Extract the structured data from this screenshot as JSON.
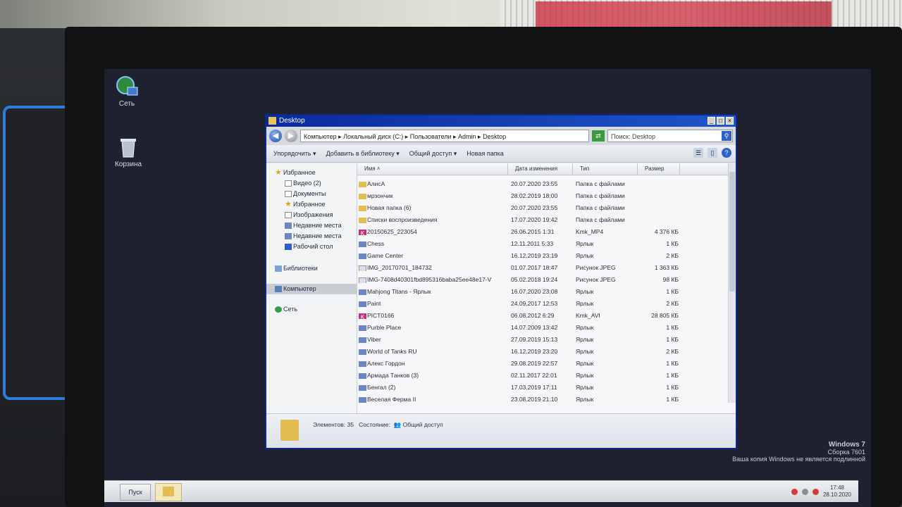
{
  "desktop": {
    "icons": [
      {
        "label": "Сеть",
        "icon": "network-icon"
      },
      {
        "label": "Корзина",
        "icon": "recycle-bin-icon"
      }
    ],
    "watermark": {
      "line1": "Windows 7",
      "line2": "Сборка 7601",
      "line3": "Ваша копия Windows не является подлинной"
    }
  },
  "window": {
    "title": "Desktop",
    "address": "Компьютер ▸ Локальный диск (C:) ▸ Пользователи ▸ Admin ▸ Desktop",
    "search_placeholder": "Поиск: Desktop",
    "toolbar": {
      "organize": "Упорядочить ▾",
      "add_library": "Добавить в библиотеку ▾",
      "share": "Общий доступ ▾",
      "new_folder": "Новая папка"
    },
    "nav": {
      "favorites": "Избранное",
      "items": [
        "Видео (2)",
        "Документы",
        "Избранное",
        "Изображения",
        "Недавние места",
        "Недавние места",
        "Рабочий стол"
      ],
      "libraries": "Библиотеки",
      "computer": "Компьютер",
      "network": "Сеть"
    },
    "columns": {
      "name": "Имя",
      "date": "Дата изменения",
      "type": "Тип",
      "size": "Размер"
    },
    "files": [
      {
        "name": "АлисА",
        "date": "20.07.2020 23:55",
        "type": "Папка с файлами",
        "size": "",
        "kind": "folder"
      },
      {
        "name": "мрзончик",
        "date": "28.02.2019 18:00",
        "type": "Папка с файлами",
        "size": "",
        "kind": "folder"
      },
      {
        "name": "Новая папка (6)",
        "date": "20.07.2020 23:55",
        "type": "Папка с файлами",
        "size": "",
        "kind": "folder"
      },
      {
        "name": "Списки воспроизведения",
        "date": "17.07.2020 19:42",
        "type": "Папка с файлами",
        "size": "",
        "kind": "folder"
      },
      {
        "name": "20150625_223054",
        "date": "26.06.2015 1:31",
        "type": "Kmk_MP4",
        "size": "4 376 КБ",
        "kind": "kmp"
      },
      {
        "name": "Chess",
        "date": "12.11.2011 5:33",
        "type": "Ярлык",
        "size": "1 КБ",
        "kind": "lnk"
      },
      {
        "name": "Game Center",
        "date": "16.12.2019 23:19",
        "type": "Ярлык",
        "size": "2 КБ",
        "kind": "lnk"
      },
      {
        "name": "IMG_20170701_184732",
        "date": "01.07.2017 18:47",
        "type": "Рисунок JPEG",
        "size": "1 363 КБ",
        "kind": "jpg"
      },
      {
        "name": "IMG-7408d40301fbd895316baba25ee48e17-V",
        "date": "05.02.2018 19:24",
        "type": "Рисунок JPEG",
        "size": "98 КБ",
        "kind": "jpg"
      },
      {
        "name": "Mahjong Titans - Ярлык",
        "date": "16.07.2020 23:08",
        "type": "Ярлык",
        "size": "1 КБ",
        "kind": "lnk"
      },
      {
        "name": "Paint",
        "date": "24.09.2017 12:53",
        "type": "Ярлык",
        "size": "2 КБ",
        "kind": "lnk"
      },
      {
        "name": "PICT0166",
        "date": "06.08.2012 6:29",
        "type": "Kmk_AVI",
        "size": "28 805 КБ",
        "kind": "kmp"
      },
      {
        "name": "Purble Place",
        "date": "14.07.2009 13:42",
        "type": "Ярлык",
        "size": "1 КБ",
        "kind": "lnk"
      },
      {
        "name": "Viber",
        "date": "27.09.2019 15:13",
        "type": "Ярлык",
        "size": "1 КБ",
        "kind": "lnk"
      },
      {
        "name": "World of Tanks RU",
        "date": "16.12.2019 23:20",
        "type": "Ярлык",
        "size": "2 КБ",
        "kind": "lnk"
      },
      {
        "name": "Алекс Гордон",
        "date": "29.08.2019 22:57",
        "type": "Ярлык",
        "size": "1 КБ",
        "kind": "lnk"
      },
      {
        "name": "Армада Танков (3)",
        "date": "02.11.2017 22:01",
        "type": "Ярлык",
        "size": "1 КБ",
        "kind": "lnk"
      },
      {
        "name": "Бенгал (2)",
        "date": "17.03.2019 17:11",
        "type": "Ярлык",
        "size": "1 КБ",
        "kind": "lnk"
      },
      {
        "name": "Веселая Ферма II",
        "date": "23.08.2019 21:10",
        "type": "Ярлык",
        "size": "1 КБ",
        "kind": "lnk"
      }
    ],
    "status": {
      "count": "Элементов: 35",
      "state_label": "Состояние:",
      "state_value": "Общий доступ"
    }
  },
  "taskbar": {
    "start": "Пуск",
    "time": "17:48",
    "date": "28.10.2020"
  }
}
